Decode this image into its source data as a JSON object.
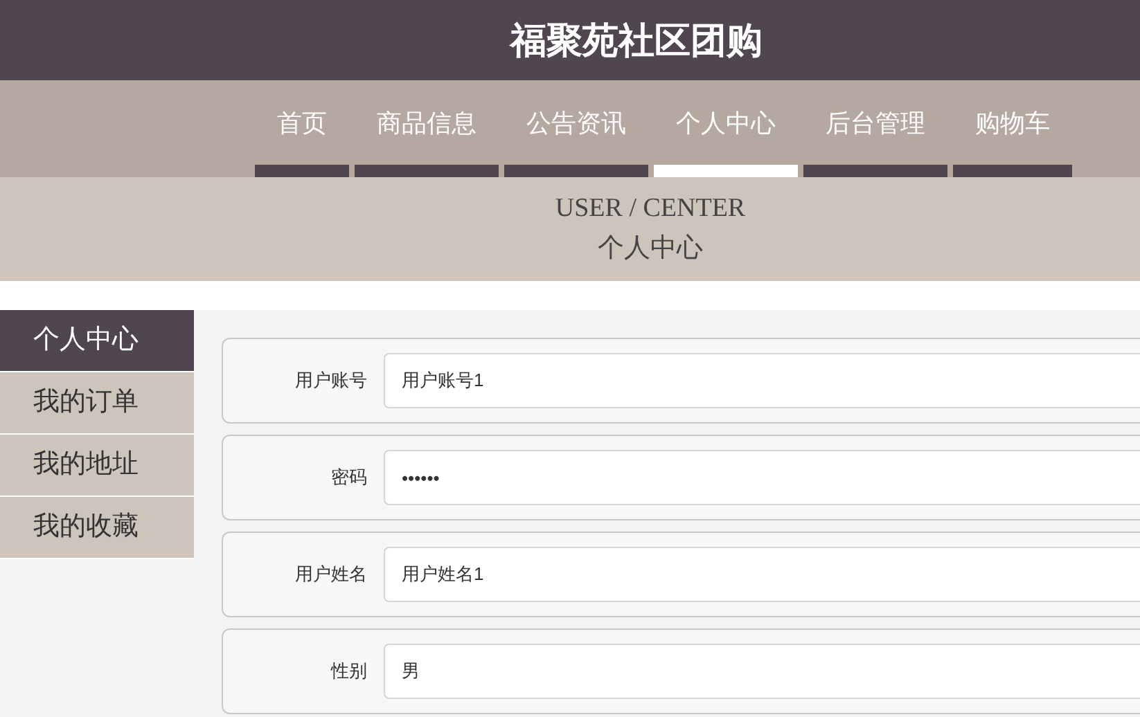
{
  "site_title": "福聚苑社区团购",
  "nav": [
    {
      "label": "首页",
      "selected": false
    },
    {
      "label": "商品信息",
      "selected": false
    },
    {
      "label": "公告资讯",
      "selected": false
    },
    {
      "label": "个人中心",
      "selected": true
    },
    {
      "label": "后台管理",
      "selected": false
    },
    {
      "label": "购物车",
      "selected": false
    }
  ],
  "banner": {
    "title": "USER / CENTER",
    "subtitle": "个人中心"
  },
  "sidebar": {
    "items": [
      {
        "label": "个人中心",
        "selected": true
      },
      {
        "label": "我的订单",
        "selected": false
      },
      {
        "label": "我的地址",
        "selected": false
      },
      {
        "label": "我的收藏",
        "selected": false
      }
    ]
  },
  "form": {
    "fields": [
      {
        "label": "用户账号",
        "value": "用户账号1"
      },
      {
        "label": "密码",
        "value": "••••••"
      },
      {
        "label": "用户姓名",
        "value": "用户姓名1"
      },
      {
        "label": "性别",
        "value": "男"
      }
    ]
  }
}
